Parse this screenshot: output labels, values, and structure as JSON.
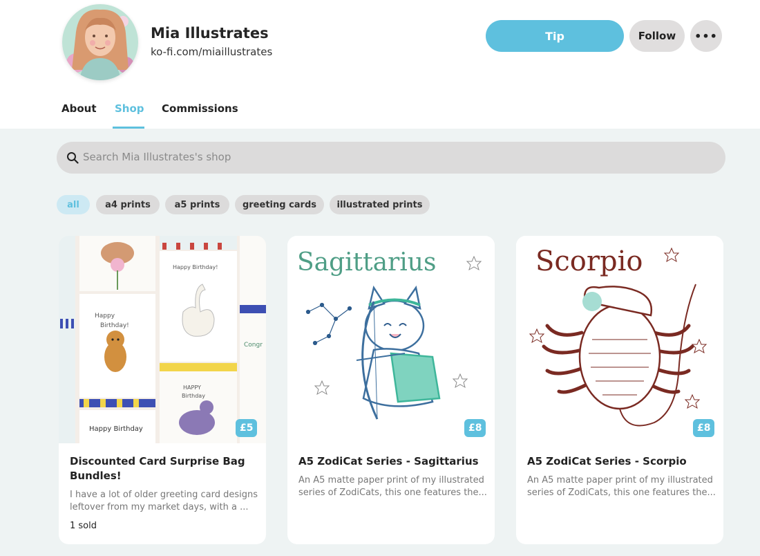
{
  "profile": {
    "name": "Mia Illustrates",
    "url": "ko-fi.com/miaillustrates"
  },
  "actions": {
    "tip_label": "Tip",
    "follow_label": "Follow",
    "more_label": "•••"
  },
  "tabs": [
    {
      "label": "About",
      "active": false
    },
    {
      "label": "Shop",
      "active": true
    },
    {
      "label": "Commissions",
      "active": false
    }
  ],
  "search": {
    "placeholder": "Search Mia Illustrates's shop"
  },
  "filters": [
    {
      "label": "all",
      "active": true
    },
    {
      "label": "a4 prints",
      "active": false
    },
    {
      "label": "a5 prints",
      "active": false
    },
    {
      "label": "greeting cards",
      "active": false
    },
    {
      "label": "illustrated prints",
      "active": false
    }
  ],
  "products": [
    {
      "title": "Discounted Card Surprise Bag Bundles!",
      "description": "I have a lot of older greeting card designs leftover from my market days, with a ...",
      "price": "£5",
      "sold": "1 sold"
    },
    {
      "title": "A5 ZodiCat Series - Sagittarius",
      "description": "An A5 matte paper print of my illustrated series of ZodiCats, this one features the...",
      "price": "£8",
      "image_text": "Sagittarius"
    },
    {
      "title": "A5 ZodiCat Series - Scorpio",
      "description": "An A5 matte paper print of my illustrated series of ZodiCats, this one features the...",
      "price": "£8",
      "image_text": "Scorpio"
    }
  ],
  "colors": {
    "accent": "#5ec0de",
    "chip_bg": "#dcdbdb",
    "shop_bg": "#eef3f3"
  }
}
